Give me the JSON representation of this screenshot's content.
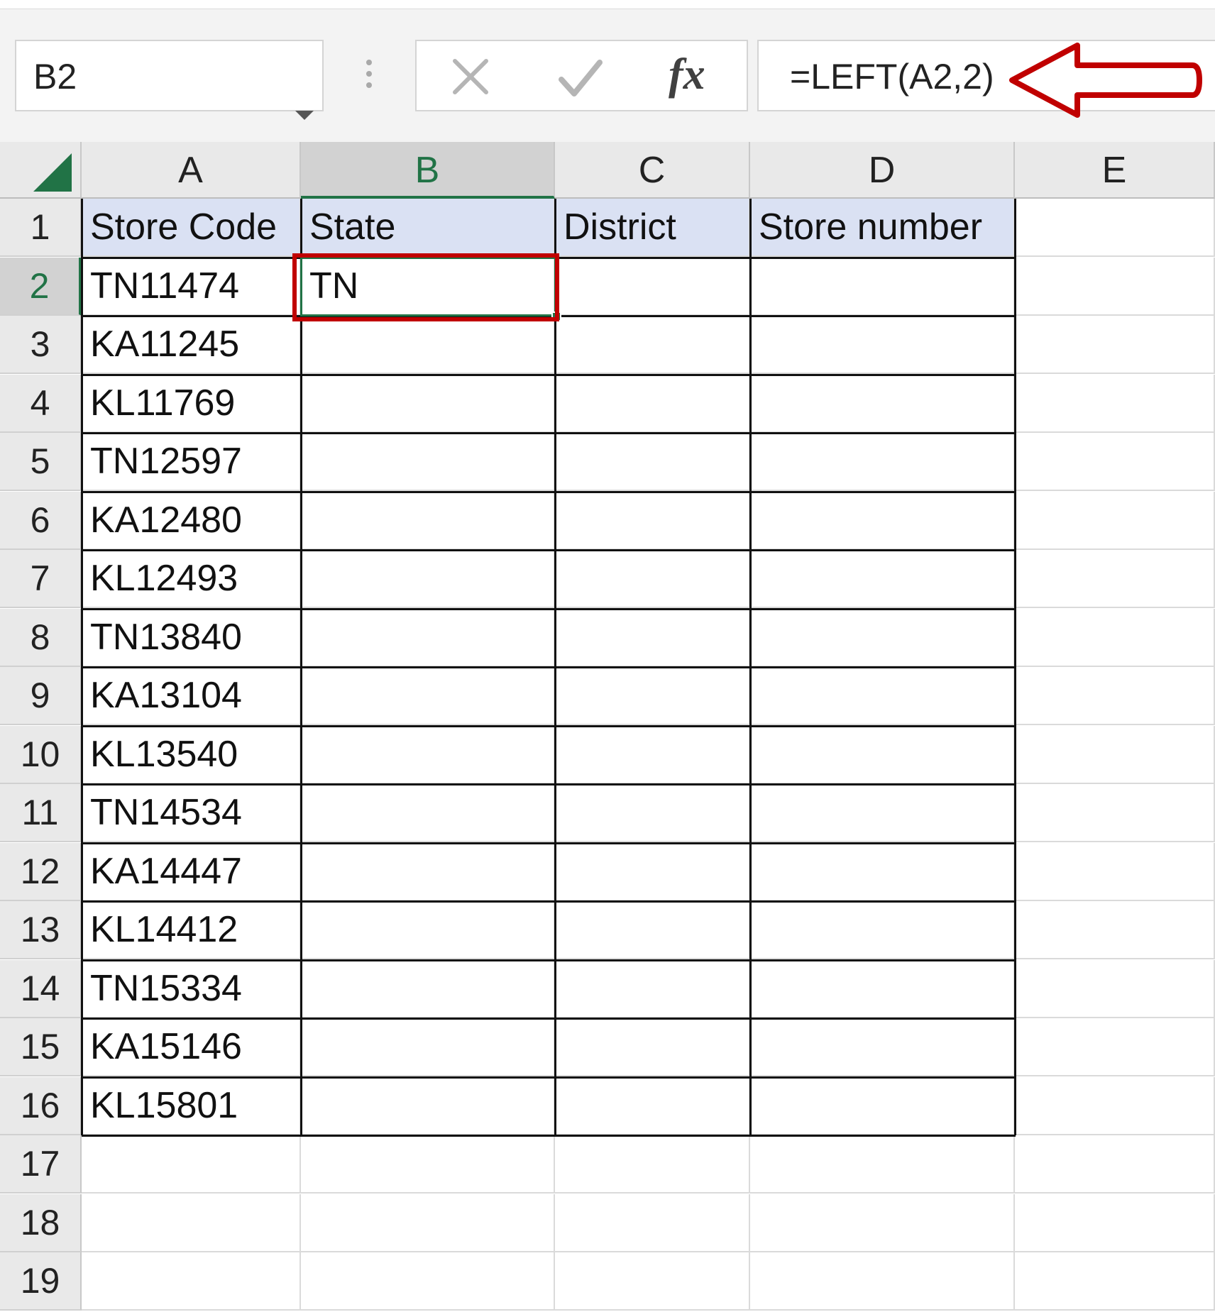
{
  "formula_bar": {
    "name_box": "B2",
    "formula": "=LEFT(A2,2)",
    "cancel_icon": "x-icon",
    "enter_icon": "check-icon",
    "fx_label": "fx"
  },
  "annotation": {
    "arrow_color": "#c00000",
    "arrow_icon": "left-arrow-outline-icon"
  },
  "sheet": {
    "columns": [
      "A",
      "B",
      "C",
      "D",
      "E"
    ],
    "selected_column": "B",
    "selected_row": "2",
    "rows": [
      "1",
      "2",
      "3",
      "4",
      "5",
      "6",
      "7",
      "8",
      "9",
      "10",
      "11",
      "12",
      "13",
      "14",
      "15",
      "16",
      "17",
      "18",
      "19"
    ],
    "header_fill": "#dae1f3",
    "accent": "#217346",
    "headers": [
      "Store Code",
      "State",
      "District",
      "Store number"
    ],
    "data": [
      [
        "TN11474",
        "TN",
        "",
        ""
      ],
      [
        "KA11245",
        "",
        "",
        ""
      ],
      [
        "KL11769",
        "",
        "",
        ""
      ],
      [
        "TN12597",
        "",
        "",
        ""
      ],
      [
        "KA12480",
        "",
        "",
        ""
      ],
      [
        "KL12493",
        "",
        "",
        ""
      ],
      [
        "TN13840",
        "",
        "",
        ""
      ],
      [
        "KA13104",
        "",
        "",
        ""
      ],
      [
        "KL13540",
        "",
        "",
        ""
      ],
      [
        "TN14534",
        "",
        "",
        ""
      ],
      [
        "KA14447",
        "",
        "",
        ""
      ],
      [
        "KL14412",
        "",
        "",
        ""
      ],
      [
        "TN15334",
        "",
        "",
        ""
      ],
      [
        "KA15146",
        "",
        "",
        ""
      ],
      [
        "KL15801",
        "",
        "",
        ""
      ]
    ]
  }
}
